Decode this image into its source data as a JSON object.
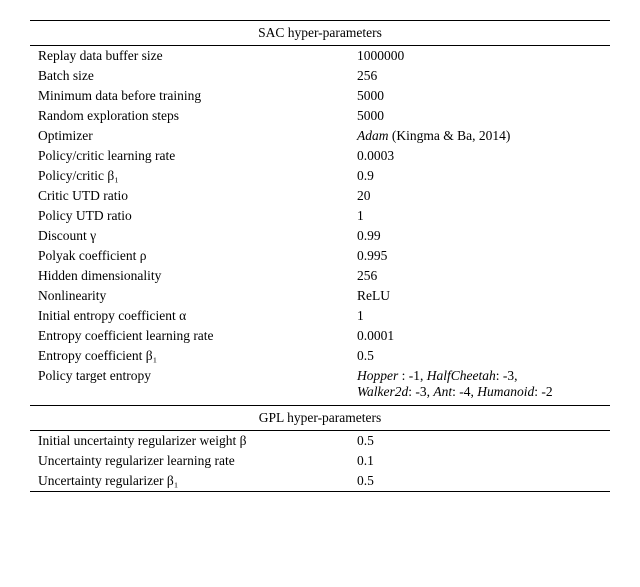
{
  "table": {
    "sac_header": "SAC hyper-parameters",
    "gpl_header": "GPL hyper-parameters",
    "sac_rows": [
      {
        "name": "Replay data buffer size",
        "value": "1000000",
        "italic": false
      },
      {
        "name": "Batch size",
        "value": "256",
        "italic": false
      },
      {
        "name": "Minimum data before training",
        "value": "5000",
        "italic": false
      },
      {
        "name": "Random exploration steps",
        "value": "5000",
        "italic": false
      },
      {
        "name": "Optimizer",
        "value_html": "<i>Adam</i> (Kingma & Ba, 2014)",
        "italic": true
      },
      {
        "name": "Policy/critic learning rate",
        "value": "0.0003",
        "italic": false
      },
      {
        "name": "Policy/critic β₁",
        "value": "0.9",
        "italic": false
      },
      {
        "name": "Critic UTD ratio",
        "value": "20",
        "italic": false
      },
      {
        "name": "Policy UTD ratio",
        "value": "1",
        "italic": false
      },
      {
        "name": "Discount γ",
        "value": "0.99",
        "italic": false
      },
      {
        "name": "Polyak coefficient ρ",
        "value": "0.995",
        "italic": false
      },
      {
        "name": "Hidden dimensionality",
        "value": "256",
        "italic": false
      },
      {
        "name": "Nonlinearity",
        "value": "ReLU",
        "italic": false
      },
      {
        "name": "Initial entropy coefficient α",
        "value": "1",
        "italic": false
      },
      {
        "name": "Entropy coefficient learning rate",
        "value": "0.0001",
        "italic": false
      },
      {
        "name": "Entropy coefficient β₁",
        "value": "0.5",
        "italic": false
      },
      {
        "name": "Policy target entropy",
        "value_html": "<i>Hopper</i> : -1, <i>HalfCheetah</i>: -3,<br><i>Walker2d</i>: -3, <i>Ant</i>: -4, <i>Humanoid</i>: -2",
        "italic": true,
        "multiline": true
      }
    ],
    "gpl_rows": [
      {
        "name": "Initial uncertainty regularizer weight β",
        "value": "0.5"
      },
      {
        "name": "Uncertainty regularizer learning rate",
        "value": "0.1"
      },
      {
        "name": "Uncertainty regularizer β₁",
        "value": "0.5"
      }
    ]
  }
}
